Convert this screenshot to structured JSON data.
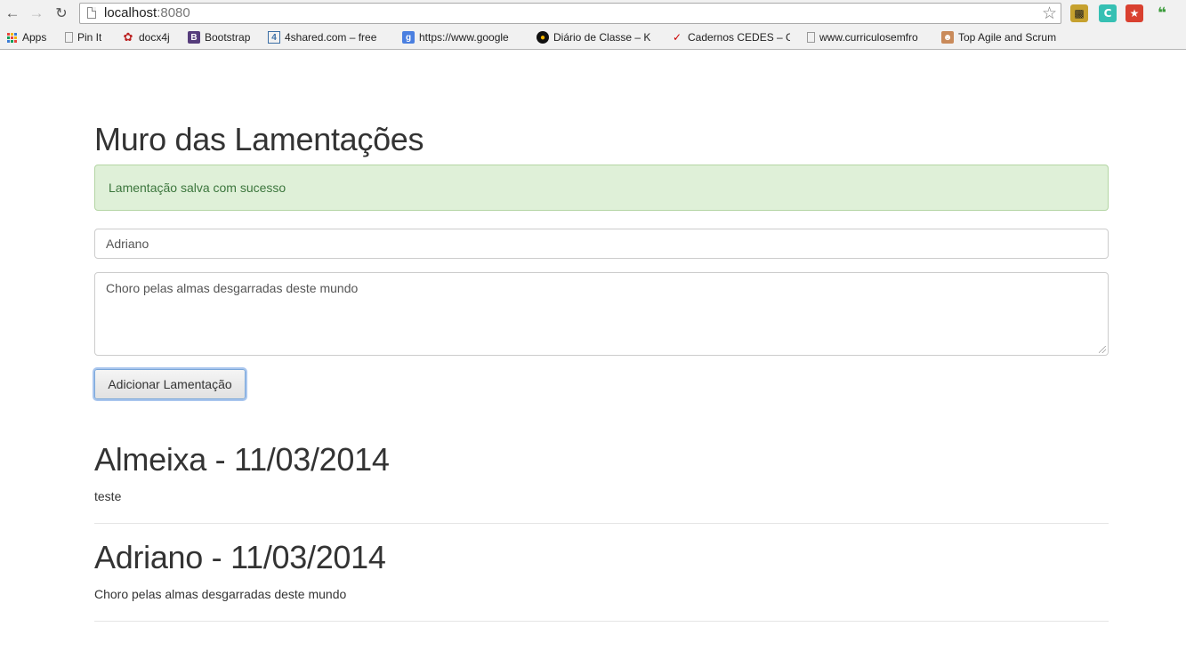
{
  "browser": {
    "url_host": "localhost",
    "url_port": ":8080",
    "bookmarks": [
      {
        "label": "Apps",
        "icon": "apps-grid-icon"
      },
      {
        "label": "Pin It",
        "icon": "page-icon"
      },
      {
        "label": "docx4j",
        "icon": "docx4j-icon"
      },
      {
        "label": "Bootstrap",
        "icon": "bootstrap-icon"
      },
      {
        "label": "4shared.com – free",
        "icon": "4shared-icon"
      },
      {
        "label": "https://www.google",
        "icon": "google-icon"
      },
      {
        "label": "Diário de Classe – K",
        "icon": "diario-icon"
      },
      {
        "label": "Cadernos CEDES – G",
        "icon": "cedes-icon"
      },
      {
        "label": "www.curriculosemfro",
        "icon": "page-icon"
      },
      {
        "label": "Top Agile and Scrum",
        "icon": "avatar-icon"
      }
    ]
  },
  "page": {
    "title": "Muro das Lamentações",
    "alert": "Lamentação salva com sucesso",
    "form": {
      "name_value": "Adriano",
      "message_value": "Choro pelas almas desgarradas deste mundo",
      "submit_label": "Adicionar Lamentação"
    },
    "entries": [
      {
        "title": "Almeixa - 11/03/2014",
        "body": "teste"
      },
      {
        "title": "Adriano - 11/03/2014",
        "body": "Choro pelas almas desgarradas deste mundo"
      }
    ]
  }
}
